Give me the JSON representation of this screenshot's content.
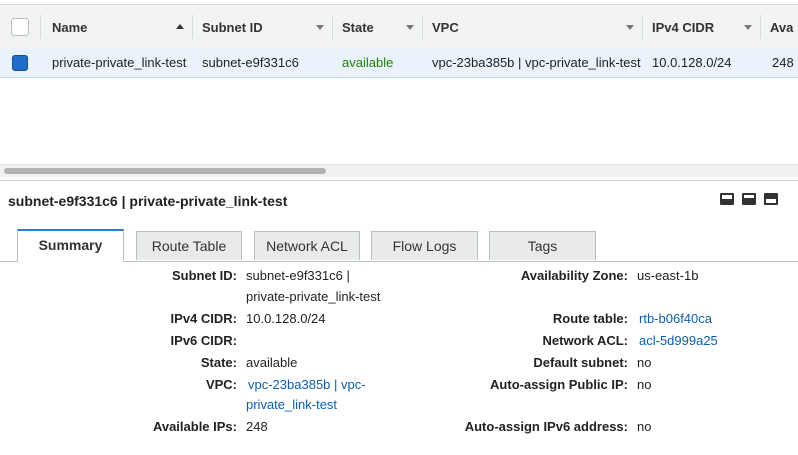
{
  "grid": {
    "columns": [
      {
        "label": "Name",
        "sort": "asc"
      },
      {
        "label": "Subnet ID"
      },
      {
        "label": "State"
      },
      {
        "label": "VPC"
      },
      {
        "label": "IPv4 CIDR"
      },
      {
        "label": "Ava"
      }
    ],
    "row": {
      "selected": true,
      "name": "private-private_link-test",
      "subnet_id": "subnet-e9f331c6",
      "state": "available",
      "vpc": "vpc-23ba385b | vpc-private_link-test",
      "ipv4_cidr": "10.0.128.0/24",
      "available": "248"
    }
  },
  "detail": {
    "title": "subnet-e9f331c6 | private-private_link-test",
    "tabs": [
      "Summary",
      "Route Table",
      "Network ACL",
      "Flow Logs",
      "Tags"
    ],
    "active_tab": "Summary",
    "left": {
      "subnet_id_label": "Subnet ID:",
      "subnet_id_line1": "subnet-e9f331c6 |",
      "subnet_id_line2": "private-private_link-test",
      "ipv4_label": "IPv4 CIDR:",
      "ipv4_value": "10.0.128.0/24",
      "ipv6_label": "IPv6 CIDR:",
      "ipv6_value": "",
      "state_label": "State:",
      "state_value": "available",
      "vpc_label": "VPC:",
      "vpc_line1": "vpc-23ba385b | vpc-",
      "vpc_line2": "private_link-test",
      "ips_label": "Available IPs:",
      "ips_value": "248"
    },
    "right": {
      "az_label": "Availability Zone:",
      "az_value": "us-east-1b",
      "route_label": "Route table:",
      "route_value": "rtb-b06f40ca",
      "acl_label": "Network ACL:",
      "acl_value": "acl-5d999a25",
      "default_label": "Default subnet:",
      "default_value": "no",
      "public_ip_label": "Auto-assign Public IP:",
      "public_ip_value": "no",
      "ipv6_addr_label": "Auto-assign IPv6 address:",
      "ipv6_addr_value": "no"
    }
  },
  "colors": {
    "selection": "#eaf3fc",
    "checkbox_selected": "#1f6cc9",
    "state_available": "#1d8102",
    "link": "#0b5fad",
    "active_tab_border": "#2b7cd3"
  }
}
